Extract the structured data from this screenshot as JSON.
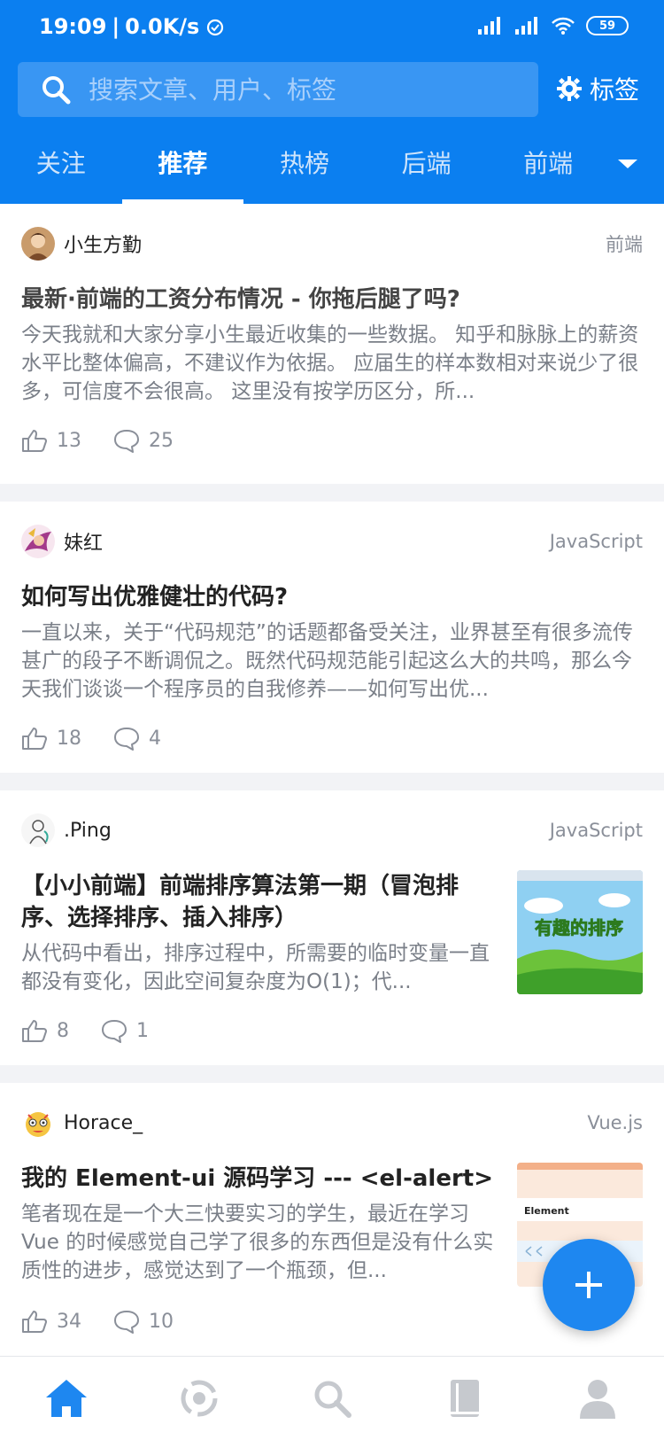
{
  "status": {
    "time": "19:09",
    "speed": "0.0K/s",
    "battery": "59"
  },
  "search": {
    "placeholder": "搜索文章、用户、标签"
  },
  "tag_button": "标签",
  "tabs": [
    {
      "label": "关注"
    },
    {
      "label": "推荐"
    },
    {
      "label": "热榜"
    },
    {
      "label": "后端"
    },
    {
      "label": "前端"
    }
  ],
  "articles": [
    {
      "author": "小生方勤",
      "tag": "前端",
      "title": "最新·前端的工资分布情况 - 你拖后腿了吗?",
      "desc": "今天我就和大家分享小生最近收集的一些数据。 知乎和脉脉上的薪资水平比整体偏高，不建议作为依据。 应届生的样本数相对来说少了很多，可信度不会很高。 这里没有按学历区分，所...",
      "likes": "13",
      "comments": "25"
    },
    {
      "author": "妹红",
      "tag": "JavaScript",
      "title": "如何写出优雅健壮的代码?",
      "desc": "一直以来，关于“代码规范”的话题都备受关注，业界甚至有很多流传甚广的段子不断调侃之。既然代码规范能引起这么大的共鸣，那么今天我们谈谈一个程序员的自我修养——如何写出优...",
      "likes": "18",
      "comments": "4"
    },
    {
      "author": ".Ping",
      "tag": "JavaScript",
      "title": "【小小前端】前端排序算法第一期（冒泡排序、选择排序、插入排序）",
      "desc": "从代码中看出，排序过程中，所需要的临时变量一直都没有变化，因此空间复杂度为O(1)；代...",
      "thumb_text": "有趣的排序",
      "likes": "8",
      "comments": "1"
    },
    {
      "author": "Horace_",
      "tag": "Vue.js",
      "title": "我的 Element-ui 源码学习 --- <el-alert>",
      "desc": "笔者现在是一个大三快要实习的学生，最近在学习 Vue 的时候感觉自己学了很多的东西但是没有什么实质性的进步，感觉达到了一个瓶颈，但...",
      "thumb_text": "Element",
      "likes": "34",
      "comments": "10"
    }
  ],
  "colors": {
    "brand": "#0b7ff0",
    "fab": "#1e87f0"
  }
}
